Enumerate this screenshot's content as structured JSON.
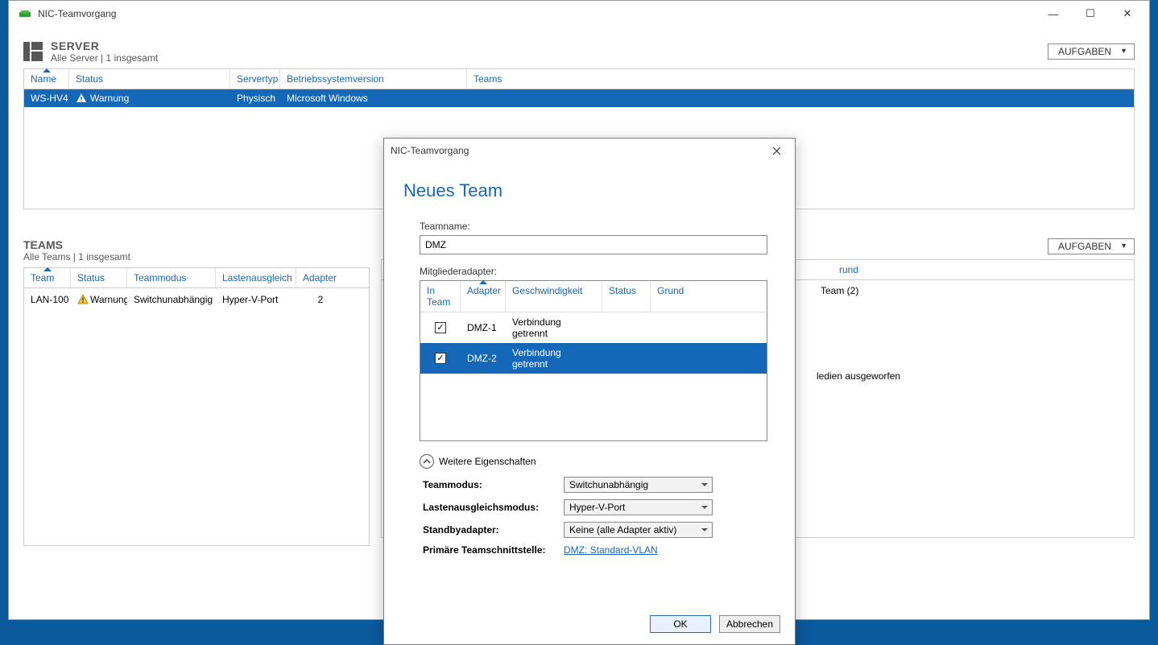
{
  "window": {
    "title": "NIC-Teamvorgang"
  },
  "winButtons": {
    "min": "—",
    "max": "☐",
    "close": "✕"
  },
  "server_section": {
    "title": "SERVER",
    "subtitle": "Alle Server | 1 insgesamt",
    "tasks_label": "AUFGABEN",
    "columns": {
      "name": "Name",
      "status": "Status",
      "type": "Servertyp",
      "os": "Betriebssystemversion",
      "teams": "Teams"
    },
    "rows": [
      {
        "name": "WS-HV4",
        "status": "Warnung",
        "type": "Physisch",
        "os": "Microsoft Windows"
      }
    ]
  },
  "teams_section": {
    "title": "TEAMS",
    "subtitle": "Alle Teams | 1 insgesamt",
    "tasks_label": "AUFGABEN",
    "columns": {
      "team": "Team",
      "status": "Status",
      "mode": "Teammodus",
      "lb": "Lastenausgleich",
      "ad": "Adapter"
    },
    "rows": [
      {
        "team": "LAN-100",
        "status": "Warnung",
        "mode": "Switchunabhängig",
        "lb": "Hyper-V-Port",
        "adapters": "2"
      }
    ]
  },
  "right_section": {
    "col_rund": "rund",
    "line1": "Team (2)",
    "line2": "ledien ausgeworfen"
  },
  "dialog": {
    "title": "NIC-Teamvorgang",
    "heading": "Neues Team",
    "teamname_label": "Teamname:",
    "teamname_value": "DMZ",
    "members_label": "Mitgliederadapter:",
    "columns": {
      "in": "In Team",
      "adapter": "Adapter",
      "speed": "Geschwindigkeit",
      "status": "Status",
      "reason": "Grund"
    },
    "adapters": [
      {
        "checked": true,
        "name": "DMZ-1",
        "speed": "Verbindung getrennt",
        "selected": false
      },
      {
        "checked": true,
        "name": "DMZ-2",
        "speed": "Verbindung getrennt",
        "selected": true
      }
    ],
    "expander_label": "Weitere Eigenschaften",
    "props": {
      "mode_label": "Teammodus:",
      "mode_value": "Switchunabhängig",
      "lb_label": "Lastenausgleichsmodus:",
      "lb_value": "Hyper-V-Port",
      "standby_label": "Standbyadapter:",
      "standby_value": "Keine (alle Adapter aktiv)",
      "primary_label": "Primäre Teamschnittstelle:",
      "primary_link": "DMZ: Standard-VLAN"
    },
    "ok": "OK",
    "cancel": "Abbrechen"
  }
}
